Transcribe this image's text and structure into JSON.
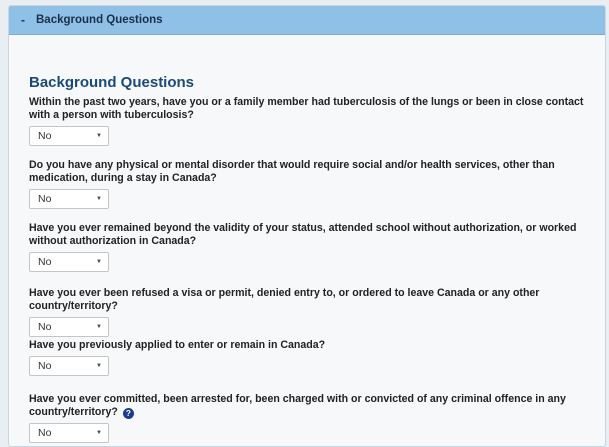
{
  "panel": {
    "toggle": "-",
    "title": "Background Questions"
  },
  "section": {
    "heading": "Background Questions"
  },
  "questions": [
    {
      "text": "Within the past two years, have you or a family member had tuberculosis of the lungs or been in close contact with a person with tuberculosis?",
      "value": "No"
    },
    {
      "text": "Do you have any physical or mental disorder that would require social and/or health services, other than medication, during a stay in Canada?",
      "value": "No"
    },
    {
      "text": "Have you ever remained beyond the validity of your status, attended school without authorization, or worked without authorization in Canada?",
      "value": "No"
    },
    {
      "text": "Have you ever been refused a visa or permit, denied entry to, or ordered to leave Canada or any other country/territory?",
      "value": "No"
    },
    {
      "text": "Have you previously applied to enter or remain in Canada?",
      "value": "No"
    },
    {
      "text": "Have you ever committed, been arrested for, been charged with or convicted of any criminal offence in any country/territory?",
      "value": "No"
    }
  ],
  "help_icon_glyph": "?",
  "select_arrow_glyph": "▼",
  "colors": {
    "header_bg": "#8fc0e6",
    "heading": "#1c4a78",
    "help_icon": "#1a3c8c"
  }
}
